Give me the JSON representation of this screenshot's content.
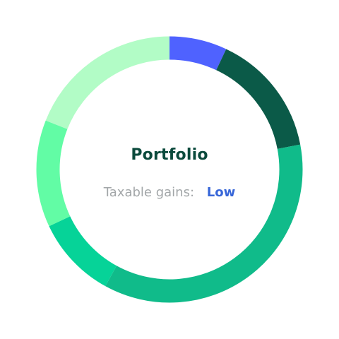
{
  "center": {
    "title": "Portfolio",
    "label": "Taxable gains:",
    "value": "Low",
    "title_color": "#0b4a3c",
    "label_color": "#a2a6a8",
    "value_color": "#3766d8"
  },
  "chart_data": {
    "type": "pie",
    "donut": true,
    "title": "",
    "slices": [
      {
        "value": 7,
        "color": "#4f62ff"
      },
      {
        "value": 15,
        "color": "#0b5a48"
      },
      {
        "value": 36,
        "color": "#10bb8a"
      },
      {
        "value": 10,
        "color": "#06d398"
      },
      {
        "value": 13,
        "color": "#62fca5"
      },
      {
        "value": 19,
        "color": "#b2fcc6"
      }
    ]
  }
}
